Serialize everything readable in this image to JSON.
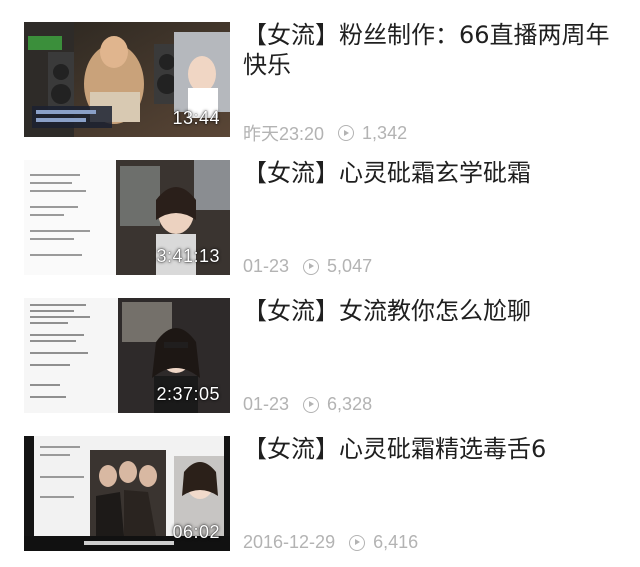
{
  "videos": [
    {
      "title": "【女流】粉丝制作：66直播两周年快乐",
      "duration": "13:44",
      "date": "昨天23:20",
      "views": "1,342"
    },
    {
      "title": "【女流】心灵砒霜玄学砒霜",
      "duration": "3:41:13",
      "date": "01-23",
      "views": "5,047"
    },
    {
      "title": "【女流】女流教你怎么尬聊",
      "duration": "2:37:05",
      "date": "01-23",
      "views": "6,328"
    },
    {
      "title": "【女流】心灵砒霜精选毒舌6",
      "duration": "06:02",
      "date": "2016-12-29",
      "views": "6,416"
    }
  ],
  "icons": {
    "views": "play-circle-icon"
  }
}
